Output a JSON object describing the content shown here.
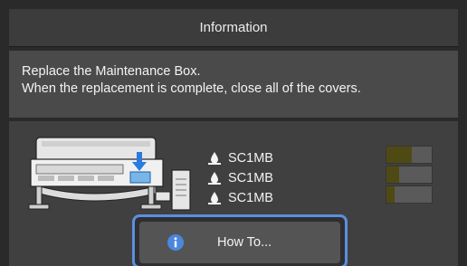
{
  "header": {
    "title": "Information"
  },
  "message": {
    "line1": "Replace the Maintenance Box.",
    "line2": "When the replacement is complete, close all of the covers."
  },
  "inks": [
    {
      "label": "SC1MB",
      "icon": "ink-drop-icon"
    },
    {
      "label": "SC1MB",
      "icon": "ink-drop-icon"
    },
    {
      "label": "SC1MB",
      "icon": "ink-drop-icon"
    }
  ],
  "levels": [
    {
      "fill": 0.55
    },
    {
      "fill": 0.28
    },
    {
      "fill": 0.18
    }
  ],
  "button": {
    "label": "How To...",
    "icon": "info-icon"
  },
  "colors": {
    "accent": "#5b8fe0",
    "level_fill": "#4f4a13",
    "info_icon": "#4a88e0",
    "arrow": "#2a7ae0"
  }
}
